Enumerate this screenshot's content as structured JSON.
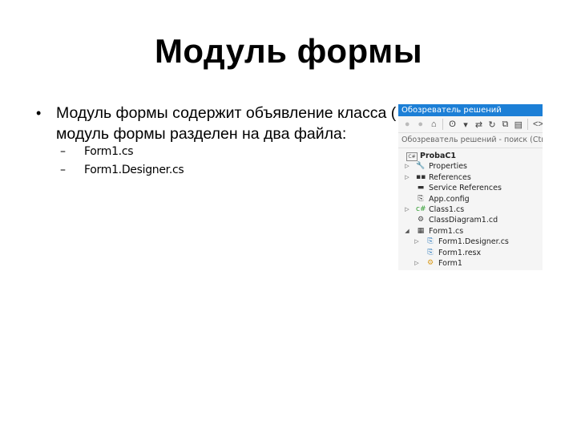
{
  "slide": {
    "title": "Модуль формы",
    "bullet": {
      "line1": "Модуль формы содержит объявление класса (",
      "line2": "модуль формы разделен на два файла:"
    },
    "sub_items": [
      {
        "text": "Form1.cs"
      },
      {
        "text": "Form1.Designer.cs"
      }
    ]
  },
  "solution_explorer": {
    "title": "Обозреватель решений",
    "title_color": "#1c7fd6",
    "search_placeholder": "Обозреватель решений - поиск (Ctrl+;)",
    "toolbar": [
      {
        "icon": "back-icon",
        "glyph": "●"
      },
      {
        "icon": "forward-icon",
        "glyph": "●"
      },
      {
        "icon": "home-icon",
        "glyph": "⌂"
      },
      {
        "icon": "pending-changes-icon",
        "glyph": "ʘ"
      },
      {
        "icon": "dropdown-icon",
        "glyph": "▾"
      },
      {
        "icon": "sync-icon",
        "glyph": "⇄"
      },
      {
        "icon": "refresh-icon",
        "glyph": "↻"
      },
      {
        "icon": "collapse-all-icon",
        "glyph": "⧉"
      },
      {
        "icon": "show-all-files-icon",
        "glyph": "▤"
      },
      {
        "icon": "view-code-icon",
        "glyph": "<>"
      }
    ],
    "tree": [
      {
        "label": "ProbaC1",
        "icon": "csharp-project-icon",
        "glyph": "C#",
        "level": 0,
        "arrow": "",
        "bold": true,
        "color": "#555"
      },
      {
        "label": "Properties",
        "icon": "wrench-icon",
        "glyph": "🔧",
        "level": 1,
        "arrow": "▷",
        "bold": false,
        "color": "#444"
      },
      {
        "label": "References",
        "icon": "references-icon",
        "glyph": "▪▪",
        "level": 1,
        "arrow": "▷",
        "bold": false,
        "color": "#333"
      },
      {
        "label": "Service References",
        "icon": "folder-icon",
        "glyph": "▬",
        "level": 1,
        "arrow": "",
        "bold": false,
        "color": "#333"
      },
      {
        "label": "App.config",
        "icon": "config-file-icon",
        "glyph": "⎘",
        "level": 1,
        "arrow": "",
        "bold": false,
        "color": "#333"
      },
      {
        "label": "Class1.cs",
        "icon": "csharp-file-icon",
        "glyph": "c#",
        "level": 1,
        "arrow": "▷",
        "bold": false,
        "color": "#2a9a2a"
      },
      {
        "label": "ClassDiagram1.cd",
        "icon": "class-diagram-icon",
        "glyph": "⚙",
        "level": 1,
        "arrow": "",
        "bold": false,
        "color": "#444"
      },
      {
        "label": "Form1.cs",
        "icon": "form-icon",
        "glyph": "▦",
        "level": 1,
        "arrow": "◢",
        "bold": false,
        "color": "#333"
      },
      {
        "label": "Form1.Designer.cs",
        "icon": "designer-file-icon",
        "glyph": "⎘",
        "level": 2,
        "arrow": "▷",
        "bold": false,
        "color": "#1c6fb8"
      },
      {
        "label": "Form1.resx",
        "icon": "resx-file-icon",
        "glyph": "⎘",
        "level": 2,
        "arrow": "",
        "bold": false,
        "color": "#1c6fb8"
      },
      {
        "label": "Form1",
        "icon": "class-icon",
        "glyph": "⚙",
        "level": 2,
        "arrow": "▷",
        "bold": false,
        "color": "#d99a1a"
      }
    ]
  }
}
